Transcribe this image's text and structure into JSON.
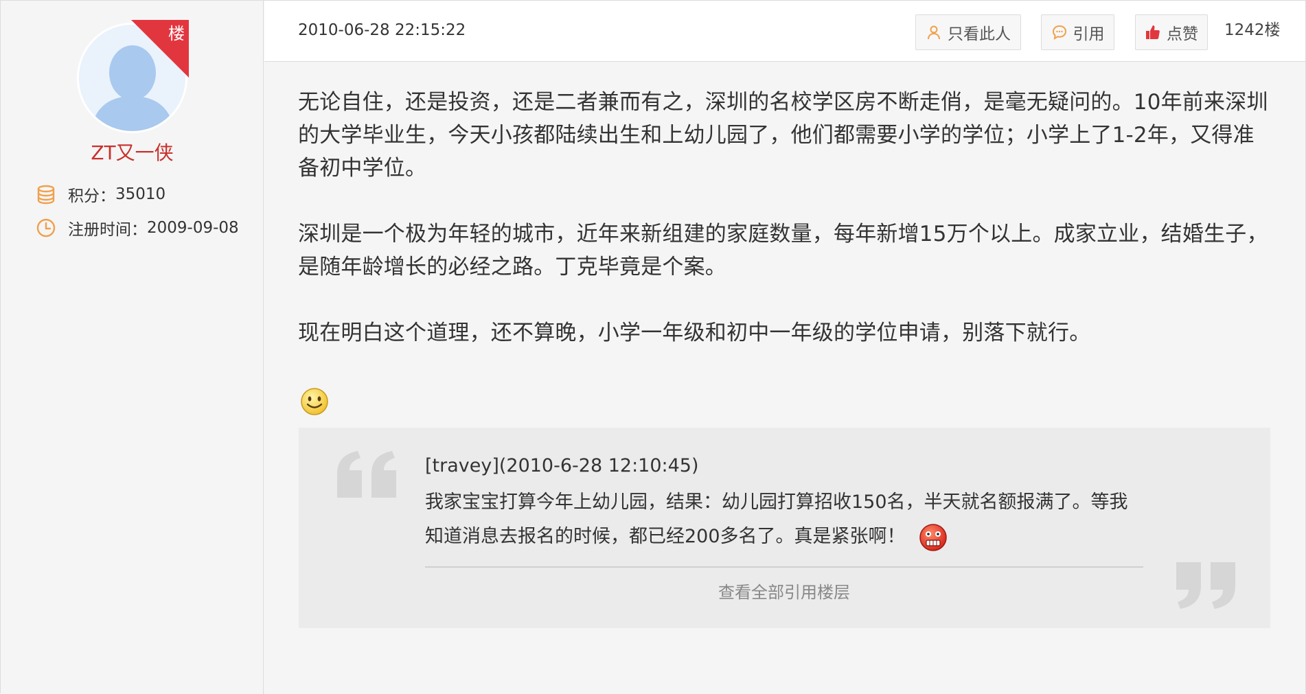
{
  "author": {
    "username": "ZT又一侠",
    "badge": "楼",
    "points_label": "积分：",
    "points_value": "35010",
    "reg_label": "注册时间：",
    "reg_value": "2009-09-08",
    "icons": {
      "points": "coins-icon",
      "reg": "clock-icon",
      "avatar": "default-avatar-icon"
    }
  },
  "post": {
    "timestamp": "2010-06-28 22:15:22",
    "actions": {
      "only_author": "只看此人",
      "quote": "引用",
      "like": "点赞"
    },
    "floor": "1242楼",
    "paragraphs": [
      "无论自住，还是投资，还是二者兼而有之，深圳的名校学区房不断走俏，是毫无疑问的。10年前来深圳的大学毕业生，今天小孩都陆续出生和上幼儿园了，他们都需要小学的学位；小学上了1-2年，又得准备初中学位。",
      "深圳是一个极为年轻的城市，近年来新组建的家庭数量，每年新增15万个以上。成家立业，结婚生子，是随年龄增长的必经之路。丁克毕竟是个案。",
      "现在明白这个道理，还不算晚，小学一年级和初中一年级的学位申请，别落下就行。"
    ],
    "emoji": "smile-emoji-icon"
  },
  "quote": {
    "author_line": "[travey](2010-6-28 12:10:45)",
    "text": "我家宝宝打算今年上幼儿园，结果：幼儿园打算招收150名，半天就名额报满了。等我知道消息去报名的时候，都已经200多名了。真是紧张啊！",
    "emoji": "nervous-emoji-icon",
    "view_all": "查看全部引用楼层"
  },
  "colors": {
    "accent_red": "#e2363f",
    "username": "#c9302c",
    "icon_orange": "#f0a04b",
    "background": "#f5f5f5",
    "quote_bg": "#ebebeb"
  }
}
